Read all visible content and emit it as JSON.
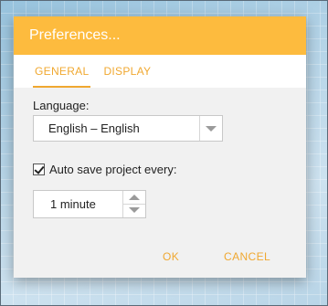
{
  "dialog": {
    "title": "Preferences..."
  },
  "tabs": [
    {
      "label": "GENERAL",
      "active": true
    },
    {
      "label": "DISPLAY",
      "active": false
    }
  ],
  "general": {
    "language_label": "Language:",
    "language_value": "English – English",
    "autosave_label": "Auto save project every:",
    "autosave_checked": true,
    "autosave_interval": "1 minute"
  },
  "actions": {
    "ok_label": "OK",
    "cancel_label": "CANCEL"
  },
  "colors": {
    "accent": "#fdbb3e",
    "accent_text": "#f0a830",
    "background": "#a8cde3"
  }
}
